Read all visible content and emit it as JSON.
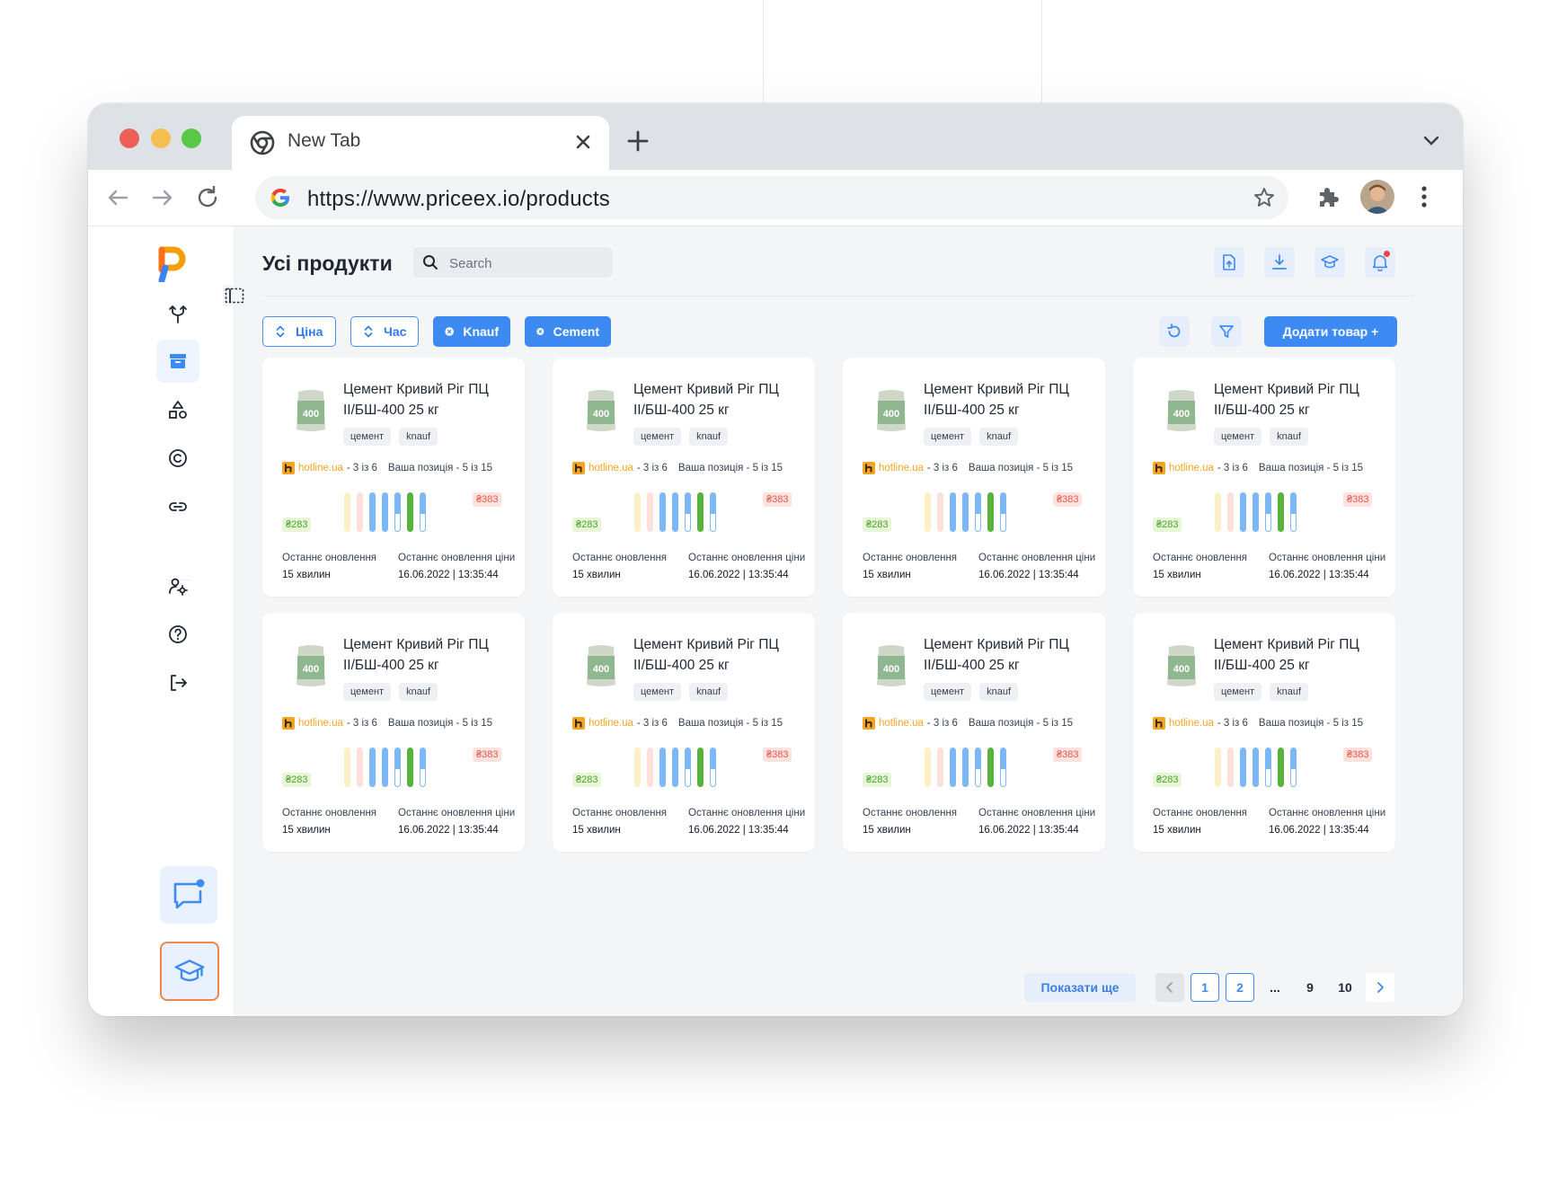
{
  "browser": {
    "tab_title": "New Tab",
    "url": "https://www.priceex.io/products"
  },
  "header": {
    "title": "Усі продукти",
    "search_placeholder": "Search"
  },
  "filters": [
    {
      "label": "Ціна",
      "type": "sort"
    },
    {
      "label": "Час",
      "type": "sort"
    },
    {
      "label": "Knauf",
      "type": "removable"
    },
    {
      "label": "Cement",
      "type": "removable"
    }
  ],
  "actions": {
    "add_label": "Додати товар +"
  },
  "product": {
    "title_line1": "Цемент Кривий Ріг ПЦ",
    "title_line2": "ІІ/БШ-400 25 кг",
    "tag1": "цемент",
    "tag2": "knauf",
    "image_label": "400",
    "source_link": "hotline.ua",
    "source_rank": "- 3 із 6",
    "your_position": "Ваша позиція - 5 із 15",
    "price_min": "₴283",
    "price_max": "₴383",
    "last_update_label": "Останнє оновлення",
    "last_update_value": "15 хвилин",
    "last_price_update_label": "Останнє оновлення ціни",
    "last_price_update_value": "16.06.2022 | 13:35:44"
  },
  "bars": [
    {
      "color": "#fdf0c6",
      "fill": 1.0
    },
    {
      "color": "#fde0d9",
      "fill": 1.0
    },
    {
      "color": "#7cb8f6",
      "fill": 1.0
    },
    {
      "color": "#7cb8f6",
      "fill": 1.0
    },
    {
      "color": "#7cb8f6",
      "fill": 0.55
    },
    {
      "color": "#56b43a",
      "fill": 1.0
    },
    {
      "color": "#7cb8f6",
      "fill": 0.55
    }
  ],
  "pagination": {
    "show_more": "Показати ще",
    "pages": [
      "1",
      "2",
      "...",
      "9",
      "10"
    ]
  },
  "colors": {
    "accent": "#3d8bf2",
    "min_price": "#4da32d",
    "max_price": "#e5574b",
    "source_link": "#f5a524"
  }
}
